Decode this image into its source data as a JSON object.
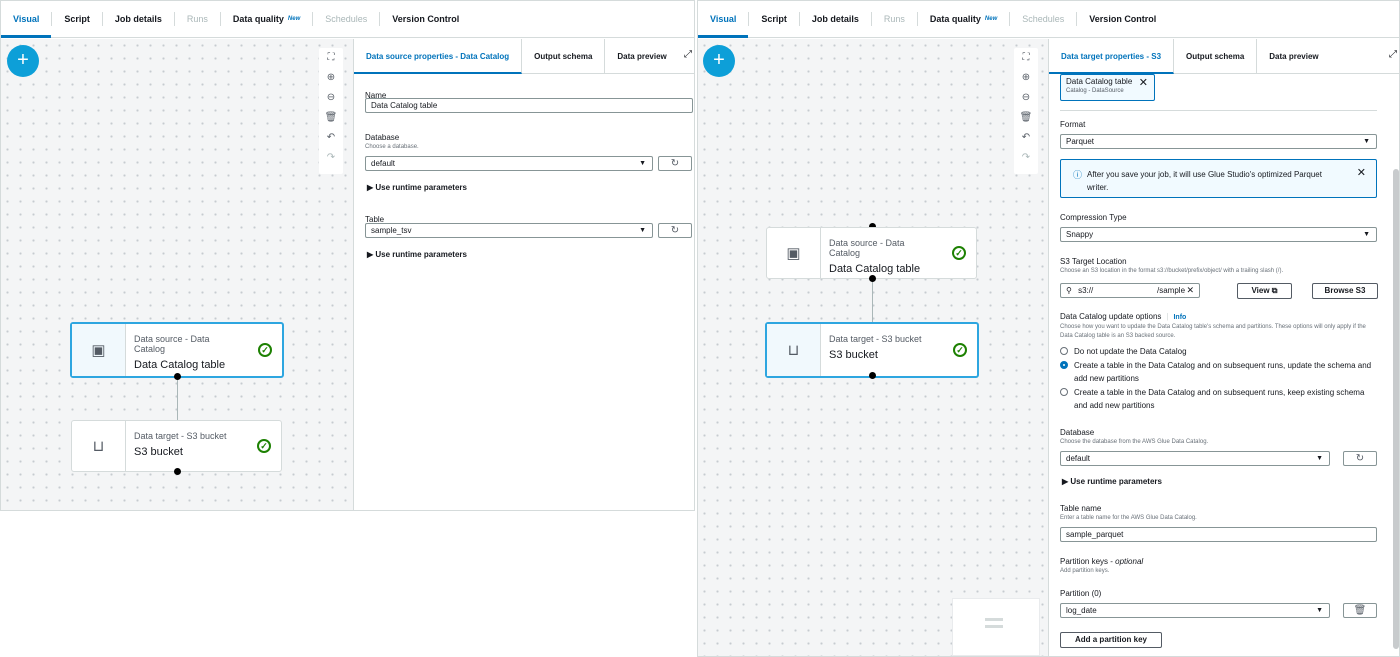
{
  "left": {
    "tabs": [
      {
        "label": "Visual"
      },
      {
        "label": "Script"
      },
      {
        "label": "Job details"
      },
      {
        "label": "Runs"
      },
      {
        "label": "Data quality",
        "badge": "New"
      },
      {
        "label": "Schedules"
      },
      {
        "label": "Version Control"
      }
    ],
    "nodes": [
      {
        "subtitle": "Data source - Data Catalog",
        "title": "Data Catalog table"
      },
      {
        "subtitle": "Data target - S3 bucket",
        "title": "S3 bucket"
      }
    ],
    "props": {
      "tabs": [
        "Data source properties - Data Catalog",
        "Output schema",
        "Data preview"
      ],
      "name_label": "Name",
      "name_value": "Data Catalog table",
      "database_label": "Database",
      "database_desc": "Choose a database.",
      "database_value": "default",
      "runtime_params": "Use runtime parameters",
      "table_label": "Table",
      "table_value": "sample_tsv",
      "runtime_params2": "Use runtime parameters"
    }
  },
  "right": {
    "tabs": [
      {
        "label": "Visual"
      },
      {
        "label": "Script"
      },
      {
        "label": "Job details"
      },
      {
        "label": "Runs"
      },
      {
        "label": "Data quality",
        "badge": "New"
      },
      {
        "label": "Schedules"
      },
      {
        "label": "Version Control"
      }
    ],
    "nodes": [
      {
        "subtitle": "Data source - Data Catalog",
        "title": "Data Catalog table"
      },
      {
        "subtitle": "Data target - S3 bucket",
        "title": "S3 bucket"
      }
    ],
    "props": {
      "tabs": [
        "Data target properties - S3",
        "Output schema",
        "Data preview"
      ],
      "token_title": "Data Catalog table",
      "token_sub": "Catalog - DataSource",
      "format_label": "Format",
      "format_value": "Parquet",
      "info_text": "After you save your job, it will use Glue Studio's optimized Parquet writer.",
      "compression_label": "Compression Type",
      "compression_value": "Snappy",
      "s3_label": "S3 Target Location",
      "s3_desc": "Choose an S3 location in the format s3://bucket/prefix/object/ with a trailing slash (/).",
      "s3_value_start": "s3://",
      "s3_value_end": "/sample_parqu",
      "view_label": "View",
      "browse_label": "Browse S3",
      "catalog_update_label": "Data Catalog update options",
      "info_link": "Info",
      "catalog_update_desc": "Choose how you want to update the Data Catalog table's schema and partitions. These options will only apply if the Data Catalog table is an S3 backed source.",
      "options": [
        "Do not update the Data Catalog",
        "Create a table in the Data Catalog and on subsequent runs, update the schema and add new partitions",
        "Create a table in the Data Catalog and on subsequent runs, keep existing schema and add new partitions"
      ],
      "selected_option": 1,
      "database_label": "Database",
      "database_desc": "Choose the database from the AWS Glue Data Catalog.",
      "database_value": "default",
      "runtime_params": "Use runtime parameters",
      "table_name_label": "Table name",
      "table_name_desc": "Enter a table name for the AWS Glue Data Catalog.",
      "table_name_value": "sample_parquet",
      "partition_keys_label": "Partition keys - ",
      "partition_keys_optional": "optional",
      "partition_keys_desc": "Add partition keys.",
      "partition_label": "Partition (0)",
      "partition_value": "log_date",
      "add_partition_label": "Add a partition key"
    }
  },
  "colors": {
    "accent": "#0073bb",
    "fab": "#0d9fd8",
    "success": "#1d8102",
    "selected_border": "#2ea6e0"
  }
}
